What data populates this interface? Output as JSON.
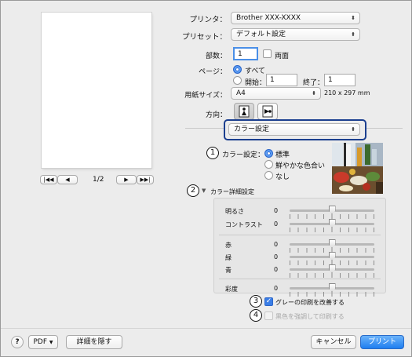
{
  "preview": {
    "page_indicator": "1/2"
  },
  "printer": {
    "label": "プリンタ：",
    "value": "Brother XXX-XXXX"
  },
  "preset": {
    "label": "プリセット：",
    "value": "デフォルト設定"
  },
  "copies": {
    "label": "部数：",
    "value": "1",
    "duplex_label": "両面"
  },
  "pages": {
    "label": "ページ：",
    "all_label": "すべて",
    "from_label": "開始：",
    "from_value": "1",
    "to_label": "終了：",
    "to_value": "1"
  },
  "paper_size": {
    "label": "用紙サイズ：",
    "value": "A4",
    "dims": "210 x 297 mm"
  },
  "orientation": {
    "label": "方向："
  },
  "section_menu": {
    "value": "カラー設定"
  },
  "color_setting": {
    "marker": "1",
    "label": "カラー設定：",
    "options": [
      "標準",
      "鮮やかな色合い",
      "なし"
    ],
    "selected_index": 0
  },
  "advanced": {
    "marker": "2",
    "label": "カラー詳細設定"
  },
  "sliders": [
    {
      "label": "明るさ",
      "value": "0",
      "level": 0.5
    },
    {
      "label": "コントラスト",
      "value": "0",
      "level": 0.5
    },
    {
      "label": "赤",
      "value": "0",
      "level": 0.5
    },
    {
      "label": "緑",
      "value": "0",
      "level": 0.5
    },
    {
      "label": "青",
      "value": "0",
      "level": 0.5
    },
    {
      "label": "彩度",
      "value": "0",
      "level": 0.5
    }
  ],
  "gray_improve": {
    "marker": "3",
    "label": "グレーの印刷を改善する",
    "checked": true
  },
  "black_enhance": {
    "marker": "4",
    "label": "黒色を強調して印刷する",
    "checked": false,
    "disabled": true
  },
  "footer": {
    "help": "?",
    "pdf": "PDF",
    "hide_details": "詳細を隠す",
    "cancel": "キャンセル",
    "print": "プリント"
  },
  "colors": {
    "accent": "#1f7ef0",
    "focus_ring": "#1b3f8f"
  }
}
